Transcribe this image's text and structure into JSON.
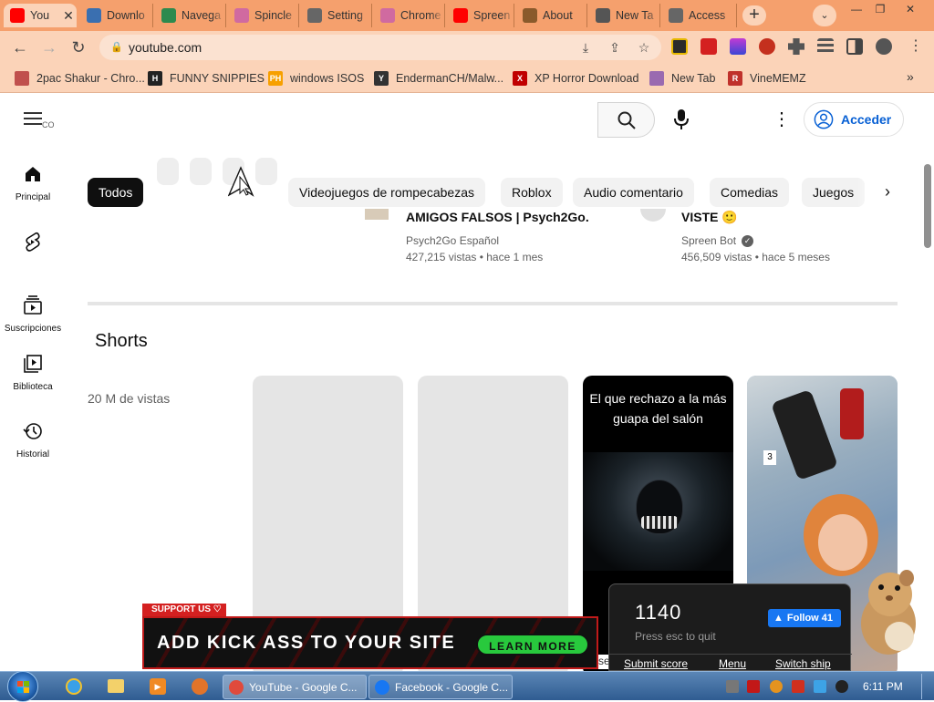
{
  "tabs": [
    {
      "label": "You",
      "icon": "youtube-icon",
      "color": "#ff0000",
      "active": true
    },
    {
      "label": "Downlo",
      "icon": "download-site-icon",
      "color": "#3a6fb0"
    },
    {
      "label": "Navega",
      "icon": "chrome-icon",
      "color": "#2d8a4e"
    },
    {
      "label": "Spincle",
      "icon": "rainbow-icon",
      "color": "#d06aa0"
    },
    {
      "label": "Setting",
      "icon": "gear-icon",
      "color": "#666666"
    },
    {
      "label": "Chrome",
      "icon": "rainbow-icon",
      "color": "#d06aa0"
    },
    {
      "label": "Spreen",
      "icon": "youtube-icon",
      "color": "#ff0000"
    },
    {
      "label": "About",
      "icon": "about-icon",
      "color": "#8a5a2b"
    },
    {
      "label": "New Ta",
      "icon": "chrome-icon",
      "color": "#555555"
    },
    {
      "label": "Access",
      "icon": "globe-icon",
      "color": "#666666"
    }
  ],
  "window": {
    "minimize": "—",
    "restore": "❐",
    "close": "✕",
    "new_tab": "+",
    "tab_search": "⌄"
  },
  "nav": {
    "back": "←",
    "forward": "→",
    "reload": "↻"
  },
  "omnibox": {
    "url": "youtube.com",
    "lock": "🔒",
    "install": "⤓",
    "share": "⇪",
    "star": "☆"
  },
  "bookmarks": [
    {
      "label": "2pac Shakur - Chro...",
      "icon_text": "",
      "color": "#c0504d"
    },
    {
      "label": "FUNNY SNIPPIES",
      "icon_text": "H",
      "color": "#222222"
    },
    {
      "label": "windows ISOS",
      "icon_text": "PH",
      "color": "#f7a000"
    },
    {
      "label": "EndermanCH/Malw...",
      "icon_text": "Y",
      "color": "#333333"
    },
    {
      "label": "XP Horror Download",
      "icon_text": "X",
      "color": "#c00000"
    },
    {
      "label": "New Tab",
      "icon_text": "",
      "color": "#9a6ab0"
    },
    {
      "label": "VineMEMZ",
      "icon_text": "R",
      "color": "#c0312b"
    }
  ],
  "bookmarks_more": "»",
  "youtube": {
    "menu_suffix": "CO",
    "signin": "Acceder",
    "sidebar": [
      {
        "label": "Principal",
        "icon": "home-icon"
      },
      {
        "label": "",
        "icon": "shorts-icon"
      },
      {
        "label": "Suscripciones",
        "icon": "subscriptions-icon"
      },
      {
        "label": "Biblioteca",
        "icon": "library-icon"
      },
      {
        "label": "Historial",
        "icon": "history-icon"
      }
    ],
    "chips": [
      "Todos",
      "Videojuegos de rompecabezas",
      "Roblox",
      "Audio comentario",
      "Comedias",
      "Juegos"
    ],
    "videos": [
      {
        "title": "AMIGOS FALSOS | Psych2Go...",
        "channel": "Psych2Go Español",
        "meta": "427,215 vistas • hace 1 mes",
        "verified": false
      },
      {
        "title": "VISTE 🙂",
        "channel": "Spreen Bot",
        "meta": "456,509 vistas • hace 5 meses",
        "verified": true
      }
    ],
    "shorts_title": "Shorts",
    "shorts_views": "20 M de vistas",
    "short_caption": "El que rechazo a la más guapa del salón",
    "short_badge": "3"
  },
  "ad": {
    "support": "SUPPORT US ♡",
    "headline": "ADD KICK ASS TO YOUR SITE",
    "cta": "LEARN MORE",
    "overflow_text": "se"
  },
  "game": {
    "score": "1140",
    "hint": "Press esc to quit",
    "follow": "Follow 41",
    "submit": "Submit score",
    "menu": "Menu",
    "switch": "Switch ship"
  },
  "taskbar": {
    "tasks": [
      {
        "label": "YouTube - Google C...",
        "color": "#e04a3c"
      },
      {
        "label": "Facebook - Google C...",
        "color": "#1877f2"
      }
    ],
    "clock": "6:11 PM"
  }
}
